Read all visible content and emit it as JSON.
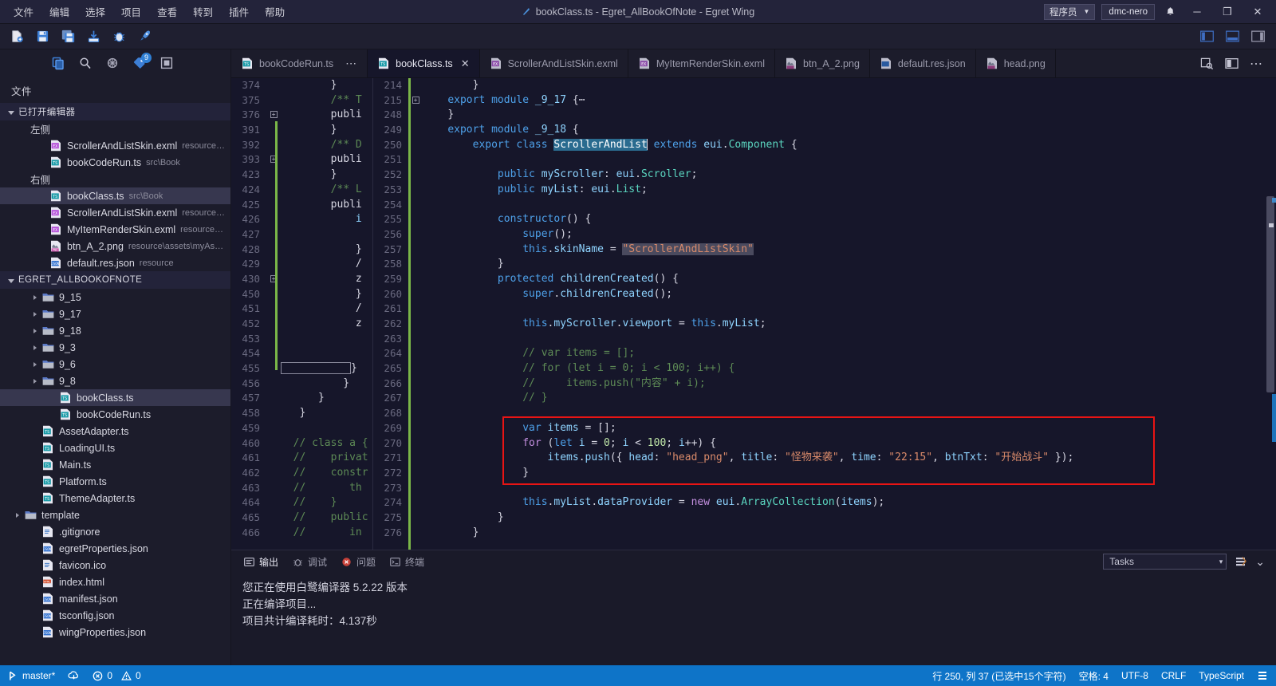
{
  "titlebar": {
    "menus": [
      "文件",
      "编辑",
      "选择",
      "项目",
      "查看",
      "转到",
      "插件",
      "帮助"
    ],
    "title": "bookClass.ts - Egret_AllBookOfNote - Egret Wing",
    "user_mode": "程序员",
    "user_name": "dmc-nero",
    "minimize": "─",
    "maximize": "❐",
    "close": "✕"
  },
  "toolbar": {
    "buttons": [
      "new-file-icon",
      "save-icon",
      "save-all-icon",
      "import-icon",
      "debug-icon",
      "run-icon"
    ],
    "layout_buttons": [
      "toggle-sidebar-icon",
      "toggle-panel-icon",
      "toggle-right-sidebar-icon"
    ]
  },
  "activitybar": {
    "items": [
      {
        "name": "explorer-icon",
        "badge": ""
      },
      {
        "name": "search-icon",
        "badge": ""
      },
      {
        "name": "debug-icon",
        "badge": ""
      },
      {
        "name": "source-control-icon",
        "badge": "9"
      },
      {
        "name": "extensions-icon",
        "badge": ""
      }
    ]
  },
  "sidebar": {
    "title": "文件",
    "open_editors_header": "已打开编辑器",
    "group_left": "左侧",
    "group_right": "右侧",
    "open_left": [
      {
        "name": "ScrollerAndListSkin.exml",
        "path": "resource\\eui_ski...",
        "icon": "exml-icon"
      },
      {
        "name": "bookCodeRun.ts",
        "path": "src\\Book",
        "icon": "ts-icon"
      }
    ],
    "open_right": [
      {
        "name": "bookClass.ts",
        "path": "src\\Book",
        "icon": "ts-icon",
        "selected": true
      },
      {
        "name": "ScrollerAndListSkin.exml",
        "path": "resource\\eui_ski...",
        "icon": "exml-icon"
      },
      {
        "name": "MyItemRenderSkin.exml",
        "path": "resource\\eui_ski...",
        "icon": "exml-icon"
      },
      {
        "name": "btn_A_2.png",
        "path": "resource\\assets\\myAssets\\But...",
        "icon": "png-icon"
      },
      {
        "name": "default.res.json",
        "path": "resource",
        "icon": "json-icon"
      }
    ],
    "project_header": "EGRET_ALLBOOKOFNOTE",
    "tree": [
      {
        "name": "9_15",
        "type": "folder",
        "indent": 1
      },
      {
        "name": "9_17",
        "type": "folder",
        "indent": 1
      },
      {
        "name": "9_18",
        "type": "folder",
        "indent": 1
      },
      {
        "name": "9_3",
        "type": "folder",
        "indent": 1
      },
      {
        "name": "9_6",
        "type": "folder",
        "indent": 1
      },
      {
        "name": "9_8",
        "type": "folder",
        "indent": 1
      },
      {
        "name": "bookClass.ts",
        "type": "ts",
        "indent": 2,
        "selected": true
      },
      {
        "name": "bookCodeRun.ts",
        "type": "ts",
        "indent": 2
      },
      {
        "name": "AssetAdapter.ts",
        "type": "ts",
        "indent": 1
      },
      {
        "name": "LoadingUI.ts",
        "type": "ts",
        "indent": 1
      },
      {
        "name": "Main.ts",
        "type": "ts",
        "indent": 1
      },
      {
        "name": "Platform.ts",
        "type": "ts",
        "indent": 1
      },
      {
        "name": "ThemeAdapter.ts",
        "type": "ts",
        "indent": 1
      },
      {
        "name": "template",
        "type": "folder",
        "indent": 0
      },
      {
        "name": ".gitignore",
        "type": "file",
        "indent": 1
      },
      {
        "name": "egretProperties.json",
        "type": "json",
        "indent": 1
      },
      {
        "name": "favicon.ico",
        "type": "file",
        "indent": 1
      },
      {
        "name": "index.html",
        "type": "html",
        "indent": 1
      },
      {
        "name": "manifest.json",
        "type": "json",
        "indent": 1
      },
      {
        "name": "tsconfig.json",
        "type": "json",
        "indent": 1
      },
      {
        "name": "wingProperties.json",
        "type": "json",
        "indent": 1
      }
    ]
  },
  "tabs": [
    {
      "label": "bookCodeRun.ts",
      "icon": "ts-icon",
      "active": false,
      "dots": "⋯"
    },
    {
      "label": "bookClass.ts",
      "icon": "ts-icon",
      "active": true,
      "close": "✕"
    },
    {
      "label": "ScrollerAndListSkin.exml",
      "icon": "exml-icon",
      "active": false
    },
    {
      "label": "MyItemRenderSkin.exml",
      "icon": "exml-icon",
      "active": false
    },
    {
      "label": "btn_A_2.png",
      "icon": "png-icon",
      "active": false
    },
    {
      "label": "default.res.json",
      "icon": "json-icon",
      "active": false
    },
    {
      "label": "head.png",
      "icon": "png-icon",
      "active": false
    }
  ],
  "tab_actions": [
    "split-preview-icon",
    "split-editor-icon",
    "more-actions-icon"
  ],
  "editor_left": {
    "lines": [
      {
        "n": "374",
        "fold": "",
        "code": "        }"
      },
      {
        "n": "375",
        "fold": "",
        "code": "        /** T"
      },
      {
        "n": "376",
        "fold": "+",
        "code": "        publi"
      },
      {
        "n": "391",
        "fold": "",
        "code": "        }"
      },
      {
        "n": "392",
        "fold": "",
        "code": "        /** D"
      },
      {
        "n": "393",
        "fold": "+",
        "code": "        publi"
      },
      {
        "n": "423",
        "fold": "",
        "code": "        }"
      },
      {
        "n": "424",
        "fold": "",
        "code": "        /** L"
      },
      {
        "n": "425",
        "fold": "",
        "code": "        publi"
      },
      {
        "n": "426",
        "fold": "",
        "code": "            i"
      },
      {
        "n": "427",
        "fold": "",
        "code": ""
      },
      {
        "n": "428",
        "fold": "",
        "code": "            }"
      },
      {
        "n": "429",
        "fold": "",
        "code": "            /"
      },
      {
        "n": "430",
        "fold": "+",
        "code": "            z"
      },
      {
        "n": "450",
        "fold": "",
        "code": "            }"
      },
      {
        "n": "451",
        "fold": "",
        "code": "            /"
      },
      {
        "n": "452",
        "fold": "",
        "code": "            z"
      },
      {
        "n": "453",
        "fold": "",
        "code": ""
      },
      {
        "n": "454",
        "fold": "",
        "code": ""
      },
      {
        "n": "455",
        "fold": "",
        "code": "            }"
      },
      {
        "n": "456",
        "fold": "",
        "code": "          }"
      },
      {
        "n": "457",
        "fold": "",
        "code": "      }"
      },
      {
        "n": "458",
        "fold": "",
        "code": "   }"
      },
      {
        "n": "459",
        "fold": "",
        "code": ""
      },
      {
        "n": "460",
        "fold": "",
        "code": "  // class a {"
      },
      {
        "n": "461",
        "fold": "",
        "code": "  //    privat"
      },
      {
        "n": "462",
        "fold": "",
        "code": "  //    constr"
      },
      {
        "n": "463",
        "fold": "",
        "code": "  //       th"
      },
      {
        "n": "464",
        "fold": "",
        "code": "  //    }"
      },
      {
        "n": "465",
        "fold": "",
        "code": "  //    public"
      },
      {
        "n": "466",
        "fold": "",
        "code": "  //       in"
      }
    ]
  },
  "editor_right": {
    "line_numbers": [
      "214",
      "215",
      "248",
      "249",
      "250",
      "251",
      "252",
      "253",
      "254",
      "255",
      "256",
      "257",
      "258",
      "259",
      "260",
      "261",
      "262",
      "263",
      "264",
      "265",
      "266",
      "267",
      "268",
      "269",
      "270",
      "271",
      "272",
      "273",
      "274",
      "275",
      "276"
    ],
    "selected_symbol": "ScrollerAndList",
    "highlighted_string": "\"ScrollerAndListSkin\"",
    "code_lines": [
      "        }",
      "    export module _9_17 {⋯",
      "    }",
      "    export module _9_18 {",
      "        export class ScrollerAndList extends eui.Component {",
      "",
      "            public myScroller: eui.Scroller;",
      "            public myList: eui.List;",
      "",
      "            constructor() {",
      "                super();",
      "                this.skinName = \"ScrollerAndListSkin\"",
      "            }",
      "            protected childrenCreated() {",
      "                super.childrenCreated();",
      "",
      "                this.myScroller.viewport = this.myList;",
      "",
      "                // var items = [];",
      "                // for (let i = 0; i < 100; i++) {",
      "                //     items.push(\"内容\" + i);",
      "                // }",
      "",
      "                var items = [];",
      "                for (let i = 0; i < 100; i++) {",
      "                    items.push({ head: \"head_png\", title: \"怪物来袭\", time: \"22:15\", btnTxt: \"开始战斗\" });",
      "                }",
      "",
      "                this.myList.dataProvider = new eui.ArrayCollection(items);",
      "            }",
      "        }"
    ]
  },
  "panel": {
    "tabs": [
      {
        "label": "输出",
        "icon": "output-icon",
        "active": true
      },
      {
        "label": "调试",
        "icon": "debug-icon",
        "active": false
      },
      {
        "label": "问题",
        "icon": "problems-icon",
        "active": false
      },
      {
        "label": "终端",
        "icon": "terminal-icon",
        "active": false
      }
    ],
    "tasks_select": "Tasks",
    "tasks_caret": "▾",
    "clear_icon": "clear-output-icon",
    "collapse_icon": "collapse-panel-icon",
    "output_lines": [
      "您正在使用白鹭编译器 5.2.22 版本",
      "正在编译项目...",
      "项目共计编译耗时：4.137秒"
    ]
  },
  "statusbar": {
    "branch": "master*",
    "sync_icon": "sync-icon",
    "errors": "0",
    "warnings": "0",
    "position": "行 250, 列 37 (已选中15个字符)",
    "indent": "空格: 4",
    "encoding": "UTF-8",
    "eol": "CRLF",
    "language": "TypeScript",
    "feedback_icon": "notifications-icon"
  }
}
